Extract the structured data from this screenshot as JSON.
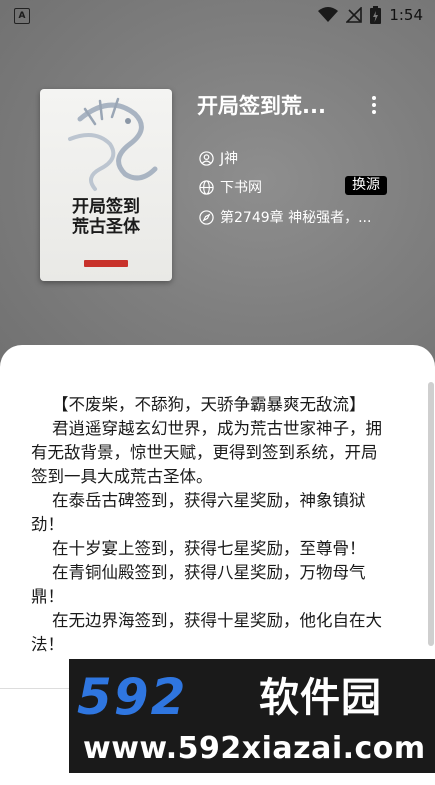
{
  "status_bar": {
    "time": "1:54",
    "app_badge": "A",
    "icons": [
      "wifi-icon",
      "no-signal-icon",
      "battery-charging-icon"
    ]
  },
  "book": {
    "title": "开局签到荒...",
    "cover_title": "开局签到\n荒古圣体",
    "author": "J神",
    "source": "下书网",
    "latest_chapter": "第2749章 神秘强者，...",
    "change_source_label": "换源"
  },
  "description": "    【不废柴，不舔狗，天骄争霸暴爽无敌流】\n    君逍遥穿越玄幻世界，成为荒古世家神子，拥有无敌背景，惊世天赋，更得到签到系统，开局签到一具大成荒古圣体。\n    在泰岳古碑签到，获得六星奖励，神象镇狱劲！\n    在十岁宴上签到，获得七星奖励，至尊骨！\n    在青铜仙殿签到，获得八星奖励，万物母气鼎！\n    在无边界海签到，获得十星奖励，他化自在大法！",
  "watermark": {
    "logo": "592",
    "name": "软件园",
    "url": "www.592xiazai.com"
  },
  "colors": {
    "header_bg": "#7d7d7d",
    "accent_blue": "#2f76e0",
    "badge_bg": "#000000"
  }
}
